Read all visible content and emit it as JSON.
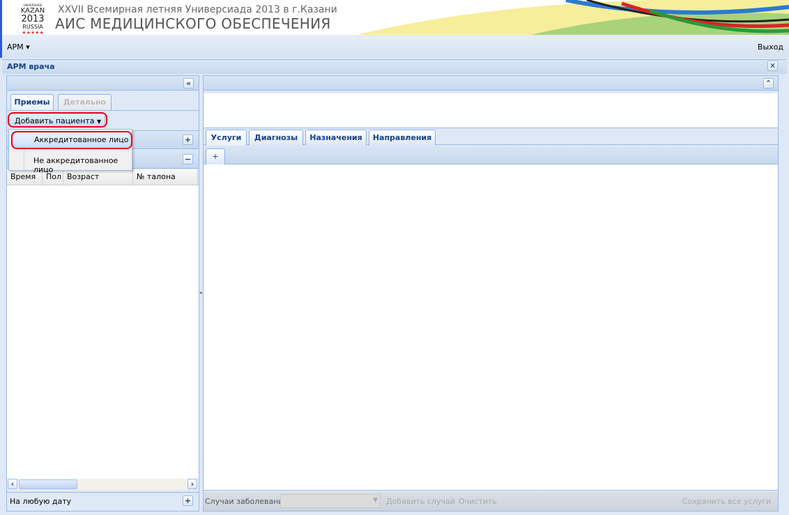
{
  "header": {
    "subtitle": "XXVII Всемирная летняя Универсиада 2013 в г.Казани",
    "title": "АИС МЕДИЦИНСКОГО ОБЕСПЕЧЕНИЯ",
    "logo": {
      "line1": "UNIVERSIADE",
      "line2": "KAZAN",
      "line3": "2013",
      "line4": "RUSSIA"
    }
  },
  "menubar": {
    "arm": "АРМ ▾",
    "exit": "Выход"
  },
  "panel": {
    "title": "АРМ врача"
  },
  "left": {
    "tabs": [
      {
        "label": "Приемы"
      },
      {
        "label": "Детально"
      }
    ],
    "add_patient": "Добавить пациента",
    "menu": [
      {
        "label": "Аккредитованное лицо"
      },
      {
        "label": "Не аккредитованное лицо"
      }
    ],
    "columns": [
      "Время",
      "Пол",
      "Возраст",
      "№ талона"
    ],
    "footer": "На любую дату"
  },
  "right": {
    "tabs": [
      {
        "label": "Услуги"
      },
      {
        "label": "Диагнозы"
      },
      {
        "label": "Назначения"
      },
      {
        "label": "Направления"
      }
    ],
    "subtab": "+",
    "toolbar": {
      "cases_label": "Случаи заболевания",
      "cases_value": "",
      "add_case": "Добавить случай",
      "clear": "Очистить",
      "save_all": "Сохранить все услуги"
    }
  }
}
